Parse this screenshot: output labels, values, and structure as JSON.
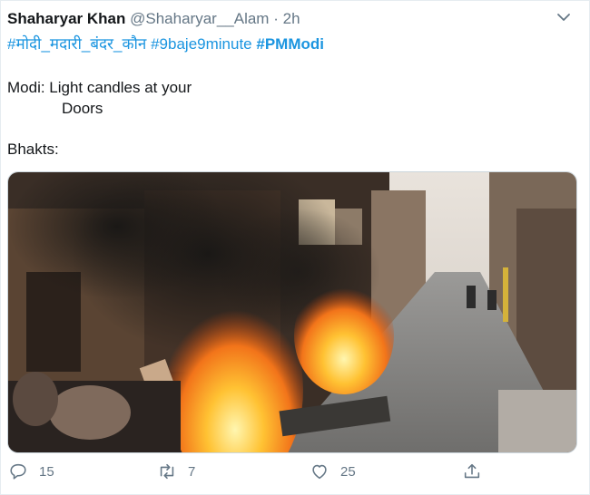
{
  "tweet": {
    "author_name": "Shaharyar Khan",
    "handle": "@Shaharyar__Alam",
    "separator": "·",
    "time": "2h",
    "hashtags": [
      {
        "text": "#मोदी_मदारी_बंदर_कौन",
        "bold": false
      },
      {
        "text": "#9baje9minute",
        "bold": false
      },
      {
        "text": "#PMModi",
        "bold": true
      }
    ],
    "line1": "Modi:  Light candles at your",
    "line2": "Doors",
    "line3": "Bhakts:"
  },
  "actions": {
    "replies": "15",
    "retweets": "7",
    "likes": "25"
  },
  "icons": [
    "chevron-down-icon",
    "reply-icon",
    "retweet-icon",
    "like-icon",
    "share-icon"
  ],
  "colors": {
    "link": "#1b95e0",
    "muted": "#657786",
    "text": "#14171a"
  }
}
